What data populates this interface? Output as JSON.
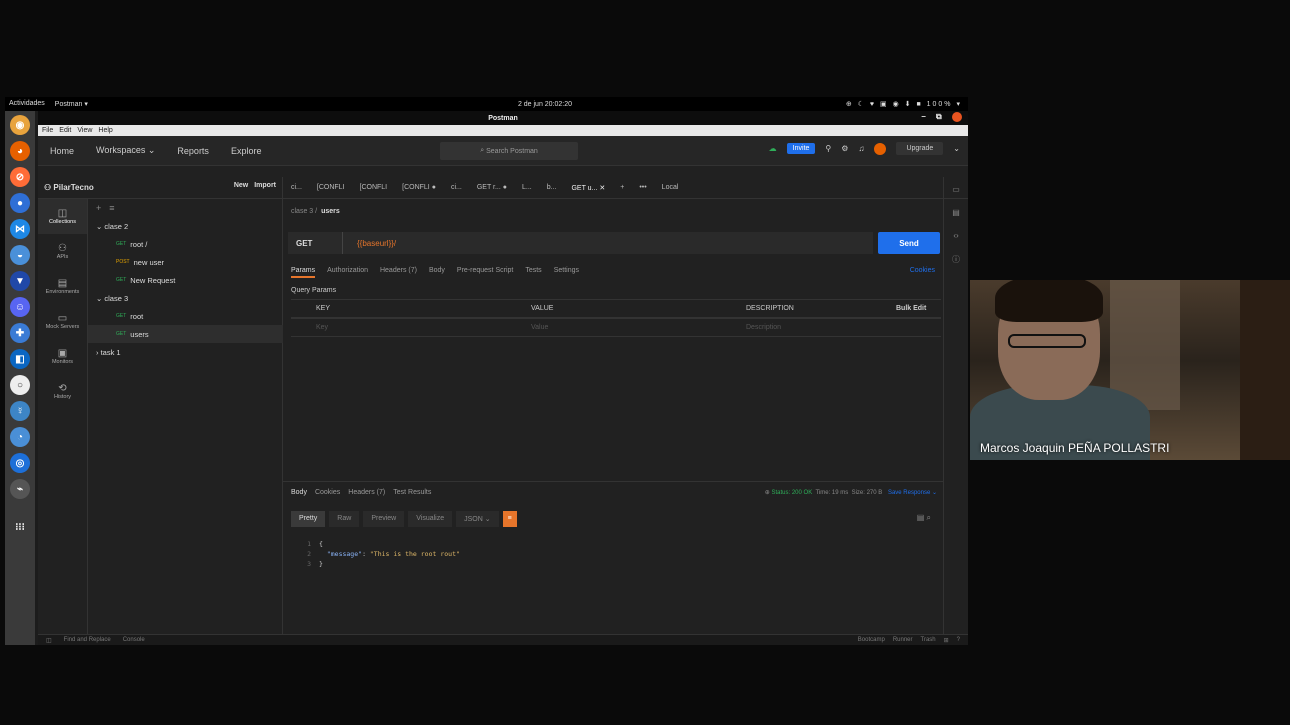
{
  "gnome": {
    "activities": "Actividades",
    "app": "Postman ▾",
    "clock": "2 de jun 20:02:20",
    "tray": "⊕ ☾ ♥ ▣ ◉ ⬇ ■ 100% ▾"
  },
  "window": {
    "title": "Postman",
    "controls": "– ⧉"
  },
  "menu": [
    "File",
    "Edit",
    "View",
    "Help"
  ],
  "topnav": {
    "home": "Home",
    "workspaces": "Workspaces ⌄",
    "reports": "Reports",
    "explore": "Explore",
    "search_placeholder": "Search Postman",
    "invite": "Invite",
    "upgrade": "Upgrade"
  },
  "sidebar": {
    "workspace": "PilarTecno",
    "new": "New",
    "import": "Import",
    "icons": [
      {
        "label": "Collections",
        "glyph": "◫"
      },
      {
        "label": "APIs",
        "glyph": "⚇"
      },
      {
        "label": "Environments",
        "glyph": "▤"
      },
      {
        "label": "Mock Servers",
        "glyph": "▭"
      },
      {
        "label": "Monitors",
        "glyph": "▣"
      },
      {
        "label": "History",
        "glyph": "⟲"
      }
    ],
    "tree": [
      {
        "text": "⌄  clase 2",
        "method": "",
        "indent": 0
      },
      {
        "text": "root /",
        "method": "GET",
        "indent": 1
      },
      {
        "text": "new user",
        "method": "POST",
        "indent": 1
      },
      {
        "text": "New Request",
        "method": "GET",
        "indent": 1
      },
      {
        "text": "⌄  clase 3",
        "method": "",
        "indent": 0
      },
      {
        "text": "root",
        "method": "GET",
        "indent": 1
      },
      {
        "text": "users",
        "method": "GET",
        "indent": 1
      },
      {
        "text": "›  task 1",
        "method": "",
        "indent": 0
      }
    ]
  },
  "tabs": [
    "ci...",
    "[CONFLI",
    "[CONFLI",
    "[CONFLI ●",
    "ci...",
    "GET r... ●",
    "L...",
    "b...",
    "GET u... ✕",
    "+",
    "•••",
    "Local"
  ],
  "request": {
    "breadcrumb_parent": "clase 3 /",
    "breadcrumb_current": "users",
    "method": "GET",
    "url": "{{baseurl}}/",
    "send": "Send",
    "tabs": [
      "Params",
      "Authorization",
      "Headers (7)",
      "Body",
      "Pre-request Script",
      "Tests",
      "Settings"
    ],
    "cookies": "Cookies",
    "query_params": "Query Params",
    "columns": [
      "KEY",
      "VALUE",
      "DESCRIPTION"
    ],
    "bulk_edit": "Bulk Edit",
    "placeholders": [
      "Key",
      "Value",
      "Description"
    ]
  },
  "response": {
    "tabs": [
      "Body",
      "Cookies",
      "Headers (7)",
      "Test Results"
    ],
    "status": "Status: 200 OK",
    "time": "Time: 19 ms",
    "size": "Size: 270 B",
    "save": "Save Response ⌄",
    "formats": [
      "Pretty",
      "Raw",
      "Preview",
      "Visualize",
      "JSON ⌄"
    ],
    "code": [
      {
        "n": "1",
        "text": "{"
      },
      {
        "n": "2",
        "key": "\"message\"",
        "value": "\"This is the root rout\""
      },
      {
        "n": "3",
        "text": "}"
      }
    ]
  },
  "statusbar": {
    "find": "Find and Replace",
    "console": "Console",
    "bootcamp": "Bootcamp",
    "runner": "Runner",
    "trash": "Trash"
  },
  "webcam": {
    "name": "Marcos Joaquin PEÑA POLLASTRI"
  },
  "colors": {
    "accent": "#e6752b",
    "send": "#1f6feb",
    "get": "#2fae59",
    "post": "#e3a300"
  }
}
